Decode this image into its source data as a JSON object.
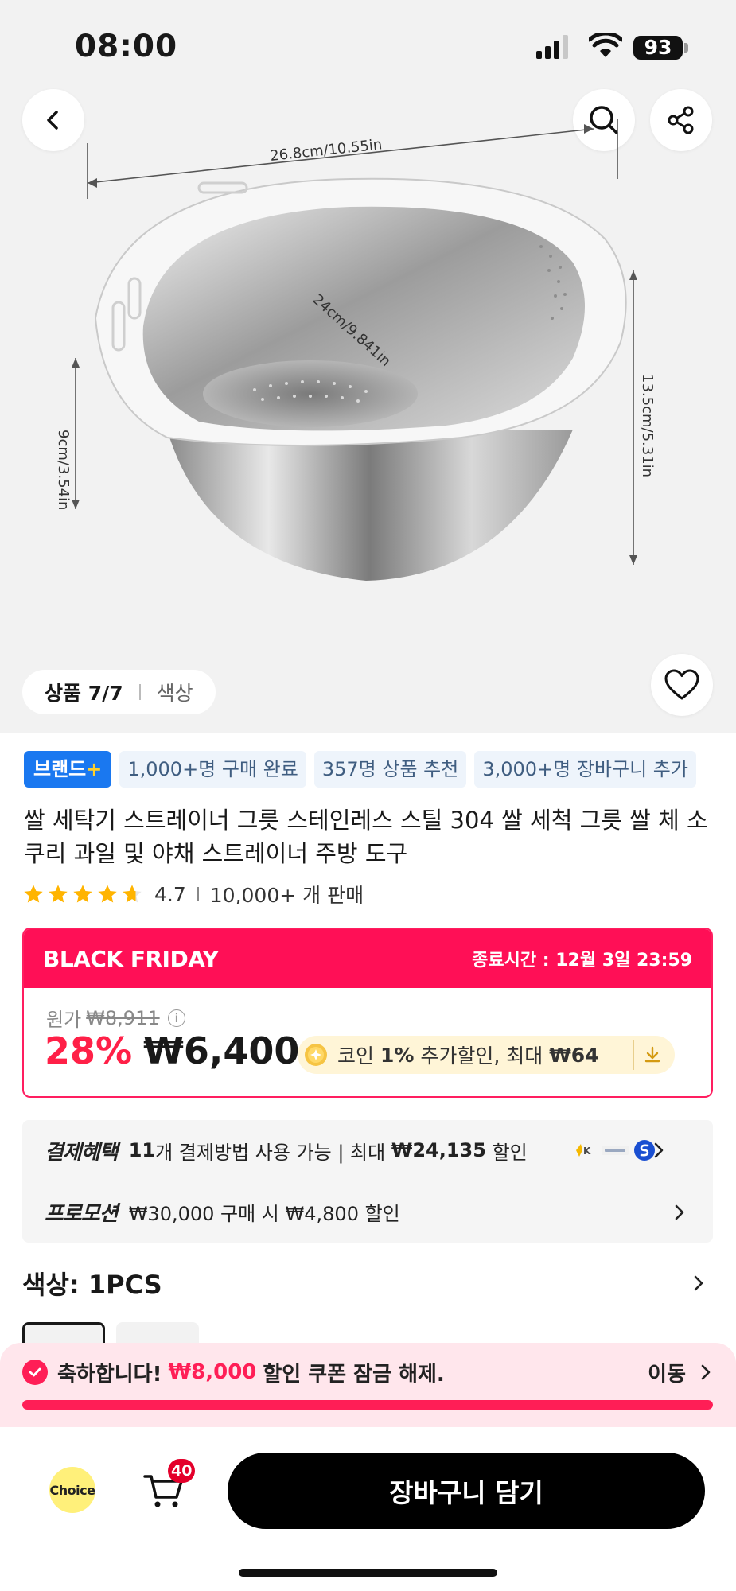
{
  "status_bar": {
    "time": "08:00",
    "battery": "93"
  },
  "gallery": {
    "counter": "상품 7/7",
    "label": "색상",
    "dimensions": {
      "width": "26.8cm/10.55in",
      "diameter": "24cm/9.841in",
      "height_right": "13.5cm/5.31in",
      "height_left": "9cm/3.54in"
    }
  },
  "tags": {
    "brand": "브랜드",
    "brand_plus": "+",
    "items": [
      "1,000+명 구매 완료",
      "357명 상품 추천",
      "3,000+명 장바구니 추가"
    ]
  },
  "product": {
    "title": "쌀 세탁기 스트레이너 그릇 스테인레스 스틸 304 쌀 세척 그릇 쌀 체 소쿠리 과일 및 야채 스트레이너 주방 도구",
    "rating": "4.7",
    "rating_value": 4.7,
    "sold": "10,000+ 개 판매"
  },
  "deal": {
    "title": "BLACK FRIDAY",
    "end_time": "종료시간 : 12월 3일 23:59",
    "original_label": "원가",
    "original_price": "₩8,911",
    "discount": "28%",
    "price": "₩6,400",
    "coin_text_1": "코인",
    "coin_percent": "1%",
    "coin_text_2": "추가할인, 최대",
    "coin_max": "₩64"
  },
  "benefits": {
    "payment_label": "결제혜택",
    "payment_count": "11",
    "payment_text_1": "개 결제방법 사용 가능 | 최대",
    "payment_amount": "₩24,135",
    "payment_text_2": "할인",
    "promotion_label": "프로모션",
    "promotion_text": "₩30,000 구매 시 ₩4,800 할인"
  },
  "option": {
    "title": "색상: 1PCS"
  },
  "coupon": {
    "text_1": "축하합니다!",
    "amount": "₩8,000",
    "text_2": "할인 쿠폰 잠금 해제.",
    "go": "이동",
    "progress": 1.0
  },
  "bottom": {
    "choice": "Choice",
    "cart_count": "40",
    "add_to_cart": "장바구니 담기"
  },
  "colors": {
    "accent": "#ff0f56",
    "brand_blue": "#1a78f0",
    "star": "#ffb400",
    "choice_yellow": "#fff07a"
  }
}
